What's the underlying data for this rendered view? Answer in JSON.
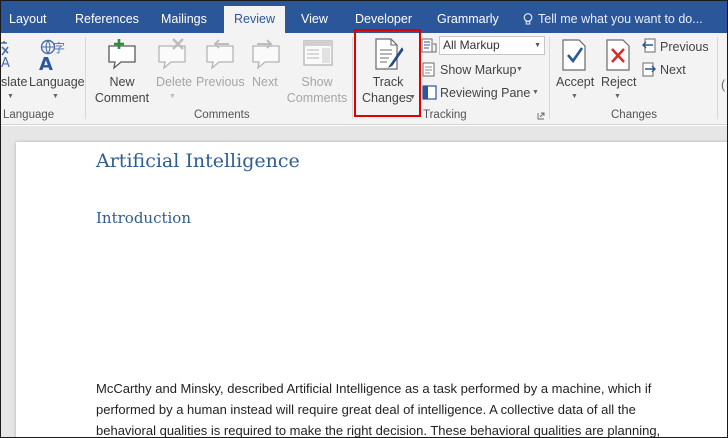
{
  "tabs": {
    "layout": "Layout",
    "references": "References",
    "mailings": "Mailings",
    "review": "Review",
    "view": "View",
    "developer": "Developer",
    "grammarly": "Grammarly"
  },
  "tell_me": "Tell me what you want to do...",
  "language_group": {
    "translate_fragment": "slate",
    "language_label": "Language",
    "group_label": "Language"
  },
  "comments_group": {
    "new_comment_line1": "New",
    "new_comment_line2": "Comment",
    "delete": "Delete",
    "previous": "Previous",
    "next": "Next",
    "show_comments_line1": "Show",
    "show_comments_line2": "Comments",
    "group_label": "Comments"
  },
  "tracking_group": {
    "track_line1": "Track",
    "track_line2": "Changes",
    "markup_select_value": "All Markup",
    "show_markup": "Show Markup",
    "reviewing_pane": "Reviewing Pane",
    "group_label": "Tracking"
  },
  "changes_group": {
    "accept": "Accept",
    "reject": "Reject",
    "previous": "Previous",
    "next": "Next",
    "group_label": "Changes"
  },
  "document": {
    "title": "Artificial Intelligence",
    "heading": "Introduction",
    "lines": [
      "McCarthy and Minsky, described Artificial Intelligence as a task performed by a machine, which if",
      "performed by a human instead will require great deal of intelligence. A collective data of all the",
      "behavioral qualities is required to make the right decision. These behavioral qualities are planning,"
    ]
  },
  "colors": {
    "tab_bar": "#2b579a",
    "ribbon": "#f3f3f3",
    "heading": "#2e5d8f",
    "highlight": "#e00000"
  }
}
